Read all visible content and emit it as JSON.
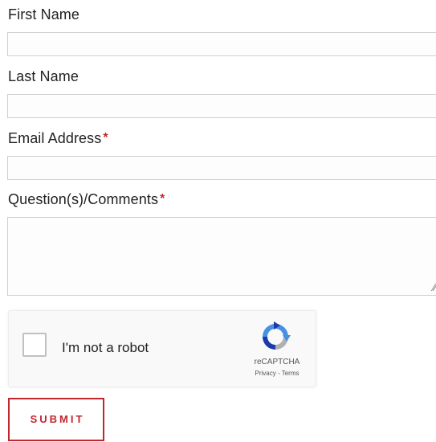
{
  "form": {
    "first_name": {
      "label": "First Name",
      "value": ""
    },
    "last_name": {
      "label": "Last Name",
      "value": ""
    },
    "email": {
      "label": "Email Address",
      "required_mark": "*",
      "value": ""
    },
    "comments": {
      "label": "Question(s)/Comments",
      "required_mark": "*",
      "value": ""
    }
  },
  "captcha": {
    "label": "I'm not a robot",
    "brand": "reCAPTCHA",
    "privacy": "Privacy",
    "separator": " - ",
    "terms": "Terms",
    "checked": false
  },
  "submit": {
    "label": "SUBMIT"
  },
  "colors": {
    "accent": "#c0272d",
    "recaptcha_blue": "#4a90e2",
    "recaptcha_dark_blue": "#1c3aa9",
    "recaptcha_grey": "#b0b0b0"
  }
}
